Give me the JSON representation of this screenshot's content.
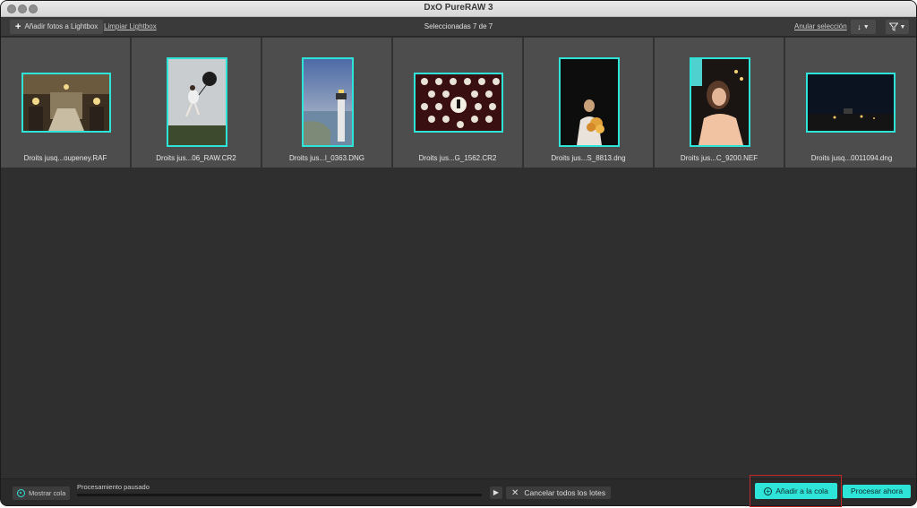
{
  "window": {
    "title": "DxO PureRAW 3"
  },
  "toolbar": {
    "add_photos_label": "Añadir fotos a Lightbox",
    "clear_lightbox_label": "Limpiar Lightbox",
    "selection_status": "Seleccionadas 7 de 7",
    "cancel_selection_label": "Anular selección",
    "sort_icon": "sort-icon",
    "filter_icon": "filter-icon"
  },
  "photos": [
    {
      "caption": "Droits jusq...oupeney.RAF",
      "icon": "photo-thumbnail"
    },
    {
      "caption": "Droits jus...06_RAW.CR2",
      "icon": "photo-thumbnail"
    },
    {
      "caption": "Droits jus...l_0363.DNG",
      "icon": "photo-thumbnail"
    },
    {
      "caption": "Droits jus...G_1562.CR2",
      "icon": "photo-thumbnail"
    },
    {
      "caption": "Droits jus...S_8813.dng",
      "icon": "photo-thumbnail"
    },
    {
      "caption": "Droits jus...C_9200.NEF",
      "icon": "photo-thumbnail"
    },
    {
      "caption": "Droits jusq...0011094.dng",
      "icon": "photo-thumbnail"
    }
  ],
  "bottom": {
    "show_queue_label": "Mostrar cola",
    "processing_status": "Procesamiento pausado",
    "cancel_all_label": "Cancelar todos los lotes",
    "add_to_queue_label": "Añadir a la cola",
    "process_now_label": "Procesar ahora"
  },
  "colors": {
    "accent": "#2ee3d8",
    "background": "#2f2f2f",
    "highlight_box": "#c0282a"
  }
}
